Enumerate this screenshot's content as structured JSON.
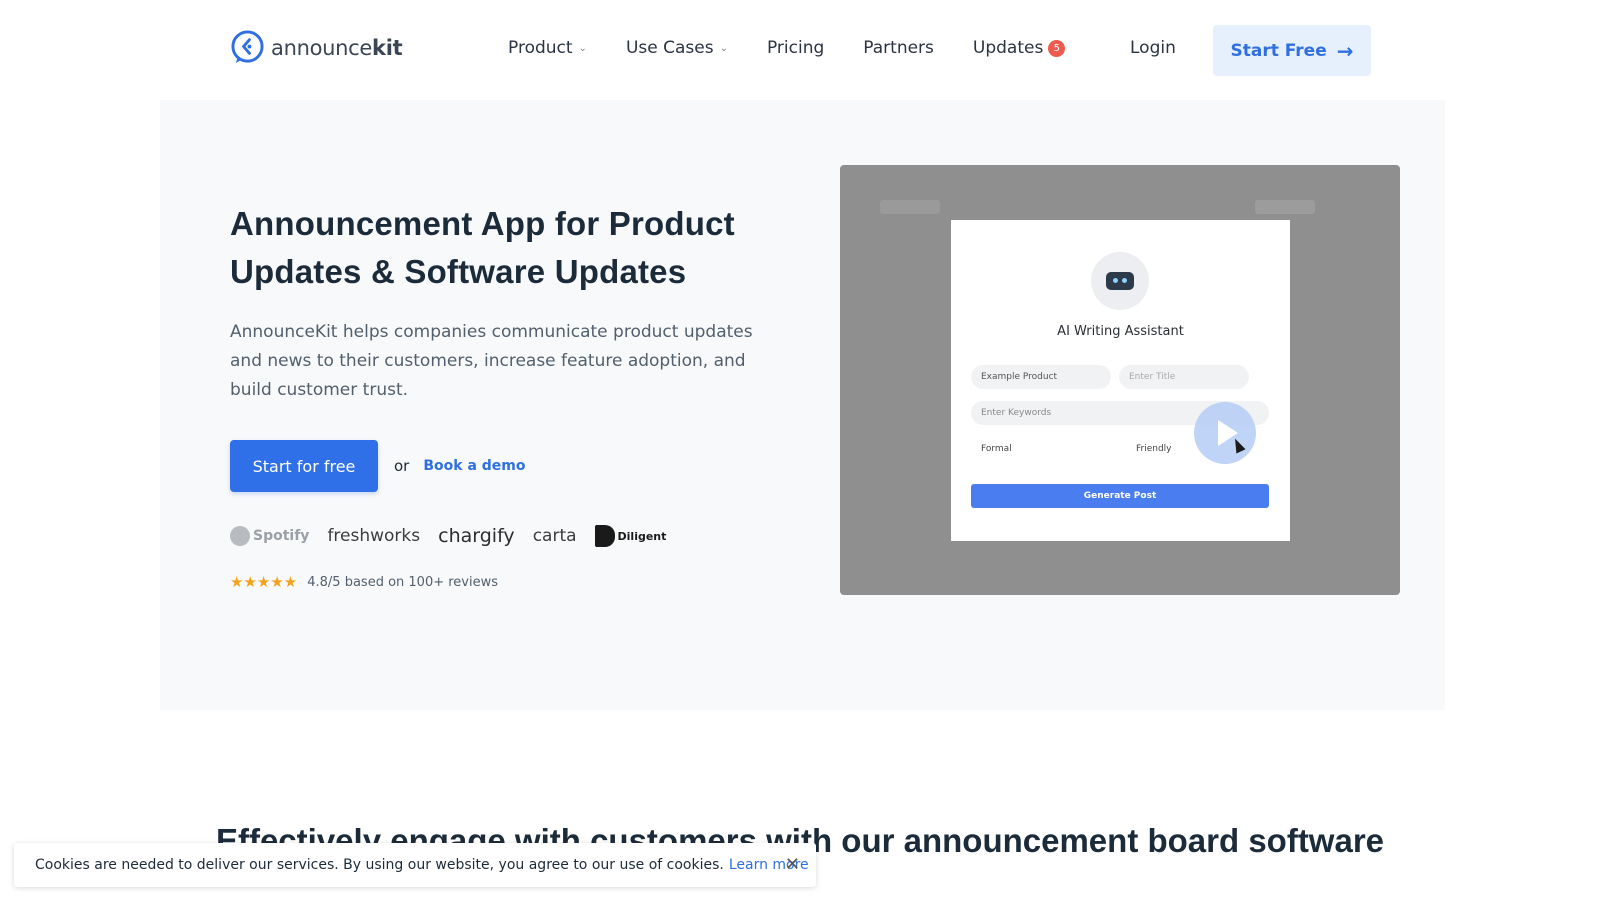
{
  "nav": {
    "logo_text_main": "announce",
    "logo_text_bold": "kit",
    "links": [
      {
        "label": "Product",
        "has_dropdown": true
      },
      {
        "label": "Use Cases",
        "has_dropdown": true
      },
      {
        "label": "Pricing",
        "has_dropdown": false
      },
      {
        "label": "Partners",
        "has_dropdown": false
      },
      {
        "label": "Updates",
        "has_dropdown": false
      }
    ],
    "updates_badge": "5",
    "login": "Login",
    "start_free": "Start Free",
    "chevron": "⌄",
    "arrow": "→"
  },
  "hero": {
    "title": "Announcement App for Product Updates & Software Updates",
    "description": "AnnounceKit helps companies communicate product updates and news to their customers, increase feature adoption, and build customer trust.",
    "primary_cta": "Start for free",
    "or": "or",
    "secondary_cta": "Book a demo",
    "logos": [
      "Spotify",
      "freshworks",
      "chargify",
      "carta",
      "Diligent"
    ],
    "stars": "★★★★★",
    "rating_text": "4.8/5 based on 100+ reviews"
  },
  "video": {
    "modal_title": "AI Writing Assistant",
    "field_product": "Example Product",
    "field_title_placeholder": "Enter Title",
    "field_keywords_placeholder": "Enter Keywords",
    "select_formal": "Formal",
    "select_friendly": "Friendly",
    "generate_button": "Generate Post"
  },
  "section": {
    "title": "Effectively engage with customers with our announcement board software"
  },
  "cookie": {
    "text": "Cookies are needed to deliver our services. By using our website, you agree to our use of cookies.",
    "link": "Learn more",
    "close": "✕"
  },
  "colors": {
    "accent": "#2f6fe8",
    "text_dark": "#1c2b3a",
    "badge": "#ef5a4f",
    "star": "#f3a21b"
  }
}
